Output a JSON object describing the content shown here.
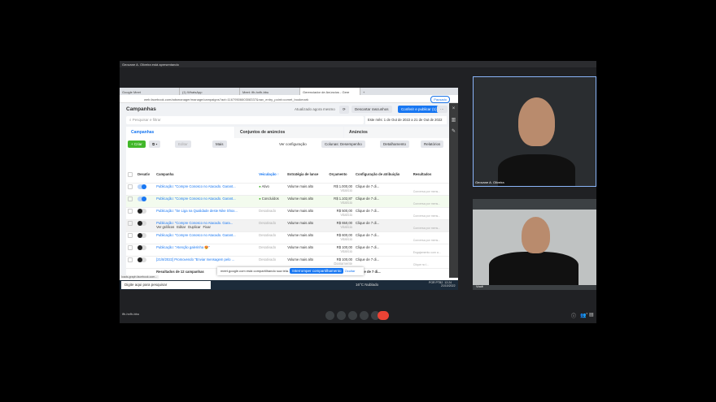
{
  "meet": {
    "presenter_banner": "Geovane A. Oliveira está apresentando",
    "meeting_code": "ifh-hxfh-bbu",
    "participants": [
      {
        "name": "Geovane A. Oliveira"
      },
      {
        "name": "Você"
      }
    ],
    "participant_count": "3"
  },
  "browser": {
    "tabs": [
      {
        "label": "Google Meet"
      },
      {
        "label": "(1) WhatsApp"
      },
      {
        "label": "Meet: ifh-hxfh-bbu"
      },
      {
        "label": "Gerenciador de Anúncios - Gere"
      }
    ],
    "url": "web.facebook.com/adsmanager/manage/campaigns?act=1167950660308337&nav_entry_point=comet_bookmark",
    "profile": "Pausado",
    "status_url": "loads-graph.facebook.com..."
  },
  "ads": {
    "title": "Campanhas",
    "updated": "Atualizado agora mesmo",
    "discard": "Descartar rascunhos",
    "publish": "Conferir e publicar (1)",
    "search_placeholder": "Pesquisar e filtrar",
    "date_range": "Este mês: 1 de Out de 2022 a 21 de Out de 2022",
    "tabs": [
      {
        "label": "Campanhas"
      },
      {
        "label": "Conjuntos de anúncios"
      },
      {
        "label": "Anúncios"
      }
    ],
    "toolbar": {
      "create": "+ Criar",
      "edit": "Editar",
      "more": "Mais",
      "view_config": "Ver configuração",
      "columns": "Colunas: Desempenho",
      "breakdown": "Detalhamento",
      "reports": "Relatórios"
    },
    "headers": [
      "Desativ",
      "Campanha",
      "Veiculação ↑",
      "Estratégia de lance",
      "Orçamento",
      "Configuração de atribuição",
      "Resultados"
    ],
    "rows": [
      {
        "on": true,
        "name": "Publicação: \"Compre Conosco no Atacado. Garant...",
        "delivery": "Ativo",
        "bid": "Volume mais alto",
        "budget": "R$ 1.000,00",
        "budget_type": "Vitalício",
        "attr": "Clique de 7 di...",
        "result": "Conversa por mens..."
      },
      {
        "on": true,
        "name": "Publicação: \"Compre Conosco no Atacado. Garant...",
        "delivery": "Concluídos",
        "bid": "Volume mais alto",
        "budget": "R$ 1.102,87",
        "budget_type": "Vitalício",
        "attr": "Clique de 7 di...",
        "result": "Conversa por mens..."
      },
      {
        "on": false,
        "name": "Publicação: \"Se Liga na Qualidade deste Nike Shox...",
        "delivery": "Desativado",
        "bid": "Volume mais alto",
        "budget": "R$ 500,00",
        "budget_type": "Vitalício",
        "attr": "Clique de 7 di...",
        "result": "Conversa por mens..."
      },
      {
        "on": false,
        "name": "Publicação: \"Compre Conosco no Atacado. Gara...",
        "delivery": "Desativado",
        "bid": "Volume mais alto",
        "budget": "R$ 650,00",
        "budget_type": "Vitalício",
        "attr": "Clique de 7 di...",
        "result": "Conversa por mens..."
      },
      {
        "on": false,
        "name": "Publicação: \"Compre Conosco no Atacado. Garant...",
        "delivery": "Desativado",
        "bid": "Volume mais alto",
        "budget": "R$ 600,00",
        "budget_type": "Vitalício",
        "attr": "Clique de 7 di...",
        "result": "Conversa por mens..."
      },
      {
        "on": false,
        "name": "Publicação: \"Atenção galerinha 😍\"",
        "delivery": "Desativado",
        "bid": "Volume mais alto",
        "budget": "R$ 100,00",
        "budget_type": "Vitalício",
        "attr": "Clique de 7 di...",
        "result": "Engajamento com a..."
      },
      {
        "on": false,
        "name": "[21/8/2022] Promovendo \"Enviar mensagem pelo ...",
        "delivery": "Desativado",
        "bid": "Volume mais alto",
        "budget": "R$ 100,00",
        "budget_type": "Diariamente",
        "attr": "Clique de 7 di...",
        "result": "Clique no l..."
      }
    ],
    "row_actions": [
      "Ver gráficos",
      "Editar",
      "Duplicar",
      "Fixar"
    ],
    "totals": {
      "label": "Resultados de 12 campanhas",
      "attr": "Clique de 7 di..."
    }
  },
  "share_bar": {
    "text": "meet.google.com está compartilhando sua tela.",
    "stop": "Interromper compartilhamento",
    "hide": "Ocultar"
  },
  "taskbar": {
    "search": "Digite aqui para pesquisar",
    "weather": "16°C Nublado",
    "lang": "POR PTB2",
    "time": "12:24",
    "date": "21/10/2022"
  },
  "colors": {
    "accent": "#1877f2",
    "create": "#42b72a",
    "end_call": "#ea4335"
  }
}
